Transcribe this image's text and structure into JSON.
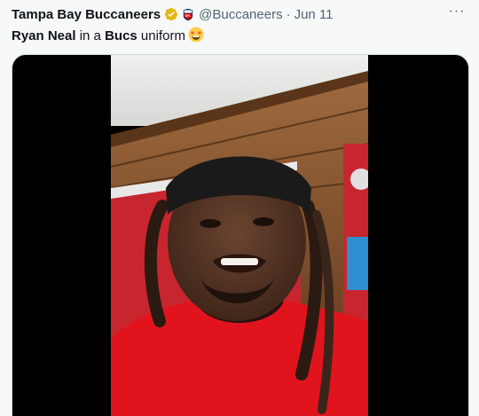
{
  "tweet": {
    "display_name": "Tampa Bay Buccaneers",
    "verified_badge": "gold-verified-badge-icon",
    "affiliation_icon": "nfl-shield-icon",
    "handle": "@Buccaneers",
    "separator": "·",
    "timestamp": "Jun 11",
    "more_icon": "more-horizontal-icon",
    "more_label": "···",
    "text_parts": {
      "bold_1": "Ryan Neal",
      "plain_1": " in a ",
      "bold_2": "Bucs",
      "plain_2": " uniform"
    },
    "emoji": "star-struck-emoji"
  },
  "colors": {
    "background": "#f7f9f9",
    "text_primary": "#0f1419",
    "text_secondary": "#536471",
    "media_border": "#cfd9de",
    "jersey_red": "#d50a0a",
    "verified_gold": "#e2b719"
  }
}
